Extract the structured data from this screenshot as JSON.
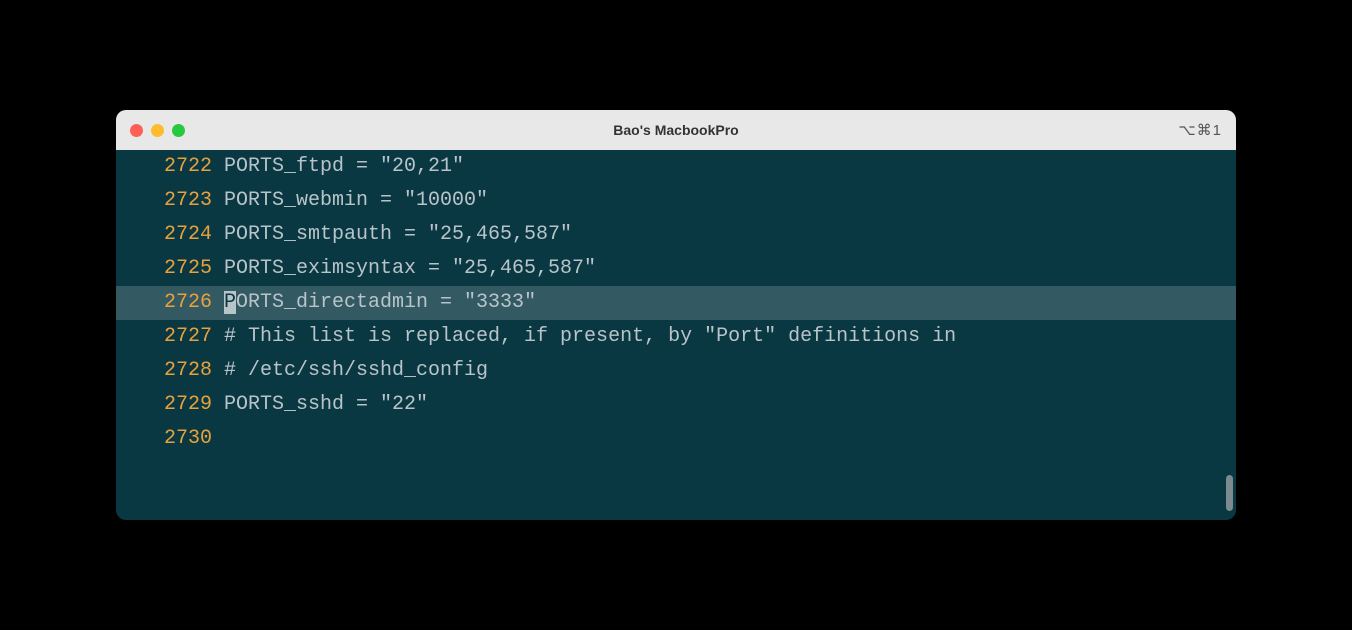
{
  "window": {
    "title": "Bao's MacbookPro",
    "shortcut": "⌥⌘1"
  },
  "lines": [
    {
      "number": "2722",
      "text": "PORTS_ftpd = \"20,21\"",
      "highlighted": false,
      "cursor": false
    },
    {
      "number": "2723",
      "text": "PORTS_webmin = \"10000\"",
      "highlighted": false,
      "cursor": false
    },
    {
      "number": "2724",
      "text": "PORTS_smtpauth = \"25,465,587\"",
      "highlighted": false,
      "cursor": false
    },
    {
      "number": "2725",
      "text": "PORTS_eximsyntax = \"25,465,587\"",
      "highlighted": false,
      "cursor": false
    },
    {
      "number": "2726",
      "text": "PORTS_directadmin = \"3333\"",
      "highlighted": true,
      "cursor": true
    },
    {
      "number": "2727",
      "text": "# This list is replaced, if present, by \"Port\" definitions in",
      "highlighted": false,
      "cursor": false
    },
    {
      "number": "2728",
      "text": "# /etc/ssh/sshd_config",
      "highlighted": false,
      "cursor": false
    },
    {
      "number": "2729",
      "text": "PORTS_sshd = \"22\"",
      "highlighted": false,
      "cursor": false
    },
    {
      "number": "2730",
      "text": "",
      "highlighted": false,
      "cursor": false
    }
  ]
}
